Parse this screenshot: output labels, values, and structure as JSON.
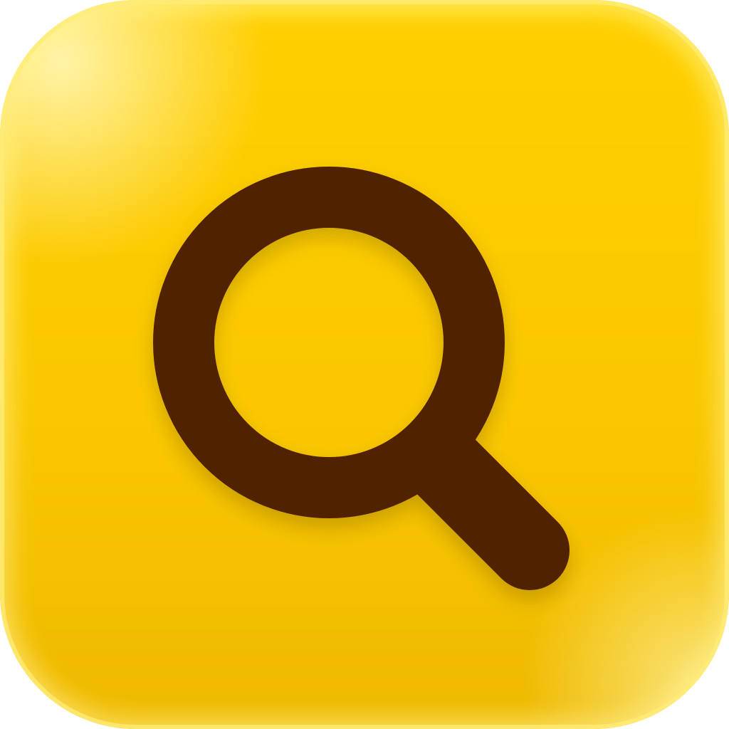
{
  "icon": {
    "glyph": "magnifying-glass-icon",
    "colors": {
      "background_top": "#ffd506",
      "background_bottom": "#efb900",
      "glyph": "#512200",
      "rim_highlight": "#fff6b0"
    }
  }
}
